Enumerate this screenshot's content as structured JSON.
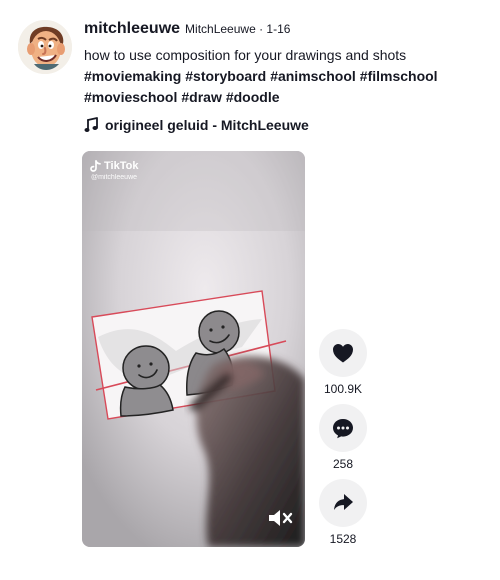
{
  "post": {
    "username": "mitchleeuwe",
    "nickname_date": "MitchLeeuwe · 1-16",
    "caption": "how to use composition for your drawings and shots",
    "hashtags": [
      "#moviemaking",
      "#storyboard",
      "#animschool",
      "#filmschool",
      "#movieschool",
      "#draw",
      "#doodle"
    ],
    "music": "origineel geluid - MitchLeeuwe"
  },
  "video": {
    "brand": "TikTok",
    "handle": "@mitchleeuwe",
    "muted": true
  },
  "actions": {
    "likes": "100.9K",
    "comments": "258",
    "shares": "1528"
  },
  "colors": {
    "text": "#161823",
    "action_background": "#f1f1f2",
    "drawing_frame": "#d84a59",
    "video_background": "#d8d5d8"
  },
  "icons": {
    "music": "music-note-icon",
    "like": "heart-icon",
    "comment": "comment-icon",
    "share": "share-arrow-icon",
    "mute": "mute-icon"
  }
}
